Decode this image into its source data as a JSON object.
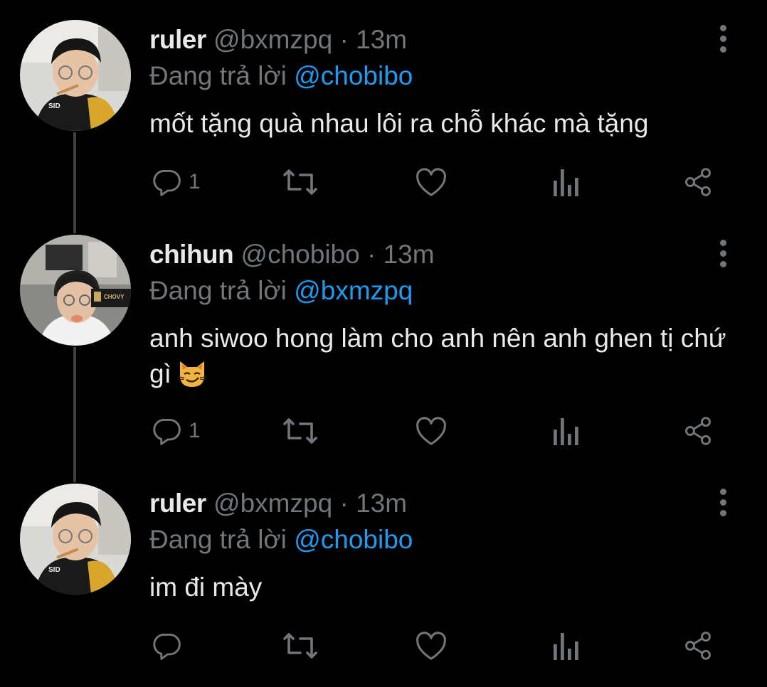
{
  "colors": {
    "background": "#000000",
    "text_primary": "#e7e9ea",
    "text_secondary": "#71767b",
    "link": "#1d9bf0",
    "thread_line": "#3e4144"
  },
  "tweets": [
    {
      "display_name": "ruler",
      "handle": "@bxmzpq",
      "separator": "·",
      "time": "13m",
      "reply_prefix": "Đang trả lời",
      "reply_to": "@chobibo",
      "text": "mốt tặng quà nhau lôi ra chỗ khác mà tặng",
      "reply_count": "1",
      "avatar": "ruler-avatar"
    },
    {
      "display_name": "chihun",
      "handle": "@chobibo",
      "separator": "·",
      "time": "13m",
      "reply_prefix": "Đang trả lời",
      "reply_to": "@bxmzpq",
      "text": "anh siwoo hong làm cho anh nên anh ghen tị chứ gì",
      "emoji": "smirking-cat-emoji",
      "reply_count": "1",
      "avatar": "chihun-avatar",
      "avatar_logo_text": "CHOVY"
    },
    {
      "display_name": "ruler",
      "handle": "@bxmzpq",
      "separator": "·",
      "time": "13m",
      "reply_prefix": "Đang trả lời",
      "reply_to": "@chobibo",
      "text": "im đi mày",
      "reply_count": "",
      "avatar": "ruler-avatar"
    }
  ],
  "icons": [
    "reply-icon",
    "retweet-icon",
    "like-icon",
    "views-icon",
    "share-icon",
    "more-options-icon"
  ]
}
